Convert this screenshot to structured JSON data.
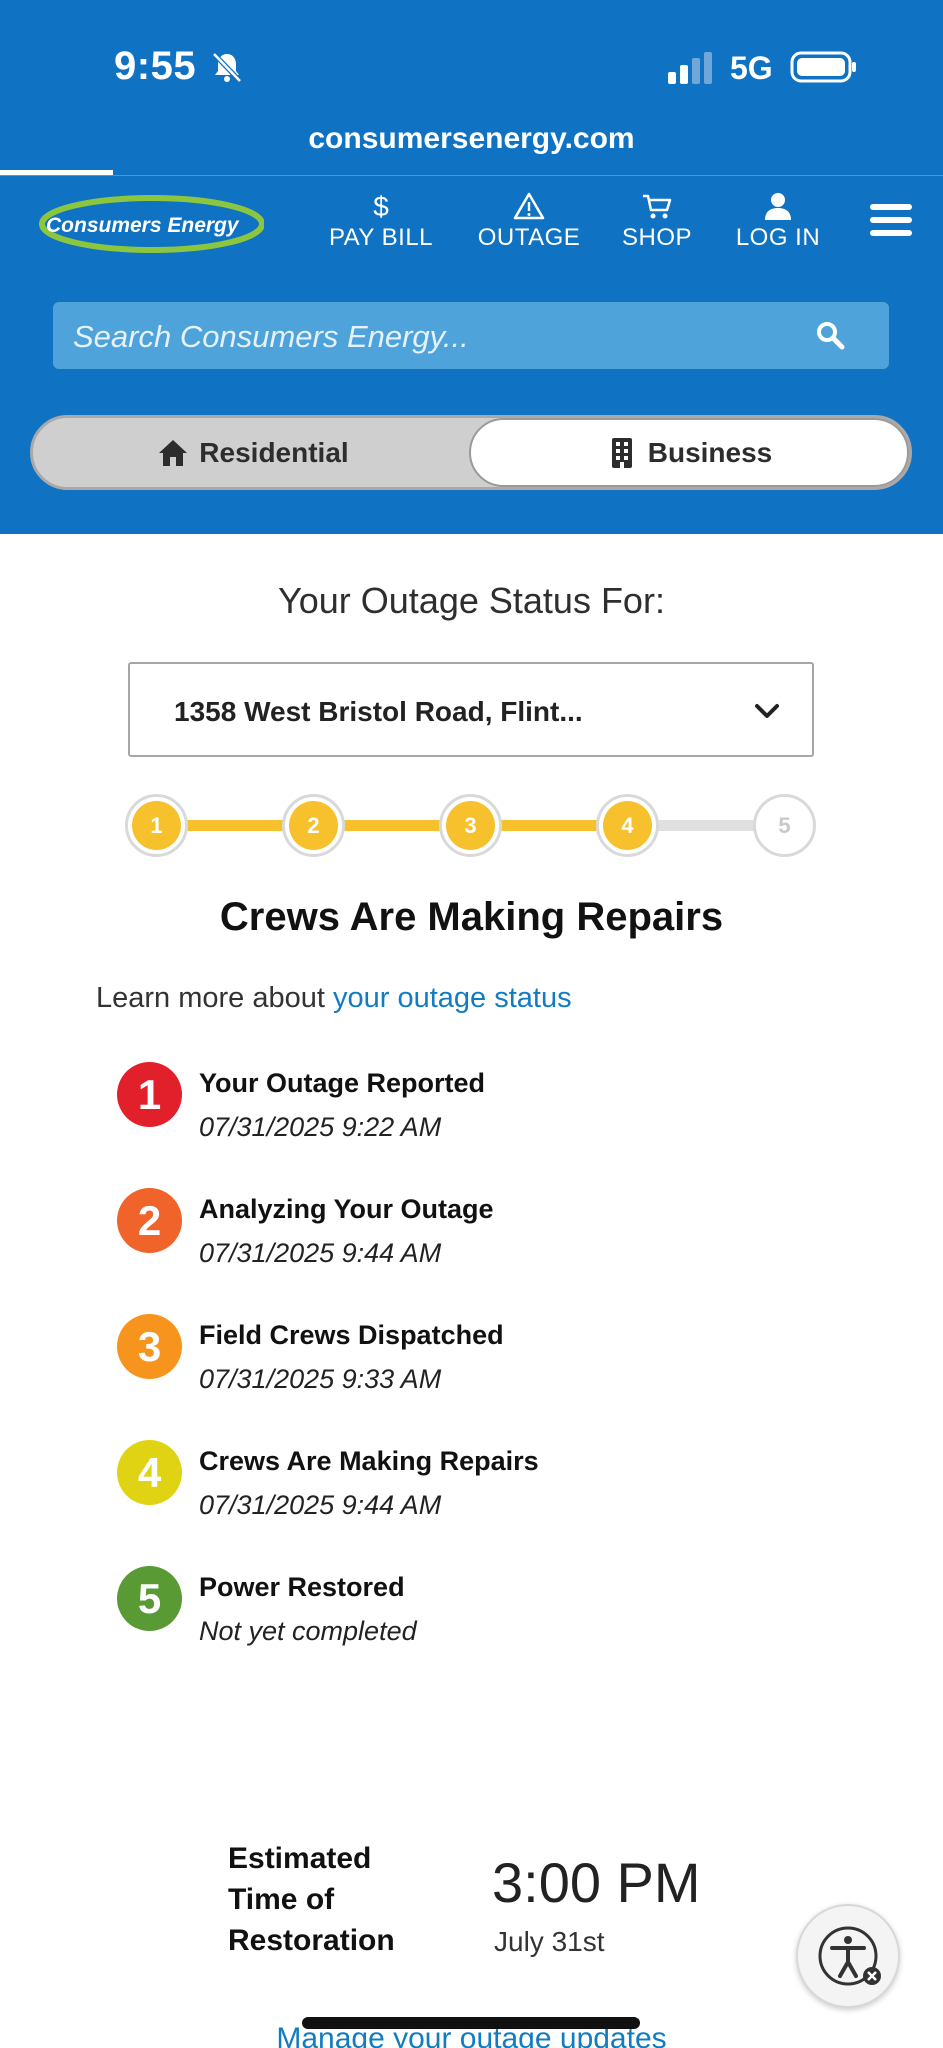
{
  "status_bar": {
    "time": "9:55",
    "network": "5G"
  },
  "browser": {
    "url": "consumersenergy.com"
  },
  "header": {
    "logo_text": "Consumers Energy",
    "nav": [
      {
        "label": "PAY BILL",
        "icon": "dollar-icon"
      },
      {
        "label": "OUTAGE",
        "icon": "warning-icon"
      },
      {
        "label": "SHOP",
        "icon": "cart-icon"
      },
      {
        "label": "LOG IN",
        "icon": "user-icon"
      }
    ],
    "search_placeholder": "Search Consumers Energy...",
    "segments": {
      "residential": "Residential",
      "business": "Business",
      "selected": "business"
    }
  },
  "outage": {
    "heading": "Your Outage Status For:",
    "address": "1358 West Bristol Road, Flint...",
    "steps": [
      "1",
      "2",
      "3",
      "4",
      "5"
    ],
    "current_step": 4,
    "title": "Crews Are Making Repairs",
    "learn_prefix": "Learn more about ",
    "learn_link": "your outage status",
    "timeline": [
      {
        "num": "1",
        "title": "Your Outage Reported",
        "date": "07/31/2025 9:22 AM",
        "color": "#e1202b"
      },
      {
        "num": "2",
        "title": "Analyzing Your Outage",
        "date": "07/31/2025 9:44 AM",
        "color": "#f0632b"
      },
      {
        "num": "3",
        "title": "Field Crews Dispatched",
        "date": "07/31/2025 9:33 AM",
        "color": "#f7941e"
      },
      {
        "num": "4",
        "title": "Crews Are Making Repairs",
        "date": "07/31/2025 9:44 AM",
        "color": "#e0d313"
      },
      {
        "num": "5",
        "title": "Power Restored",
        "date": "Not yet completed",
        "color": "#5a9a34"
      }
    ],
    "eta_label": "Estimated Time of Restoration",
    "eta_time": "3:00 PM",
    "eta_date": "July 31st",
    "manage_link": "Manage your outage updates"
  },
  "colors": {
    "brand_blue": "#0f72c3",
    "step_yellow": "#f7c12e",
    "link_blue": "#127cc1"
  }
}
